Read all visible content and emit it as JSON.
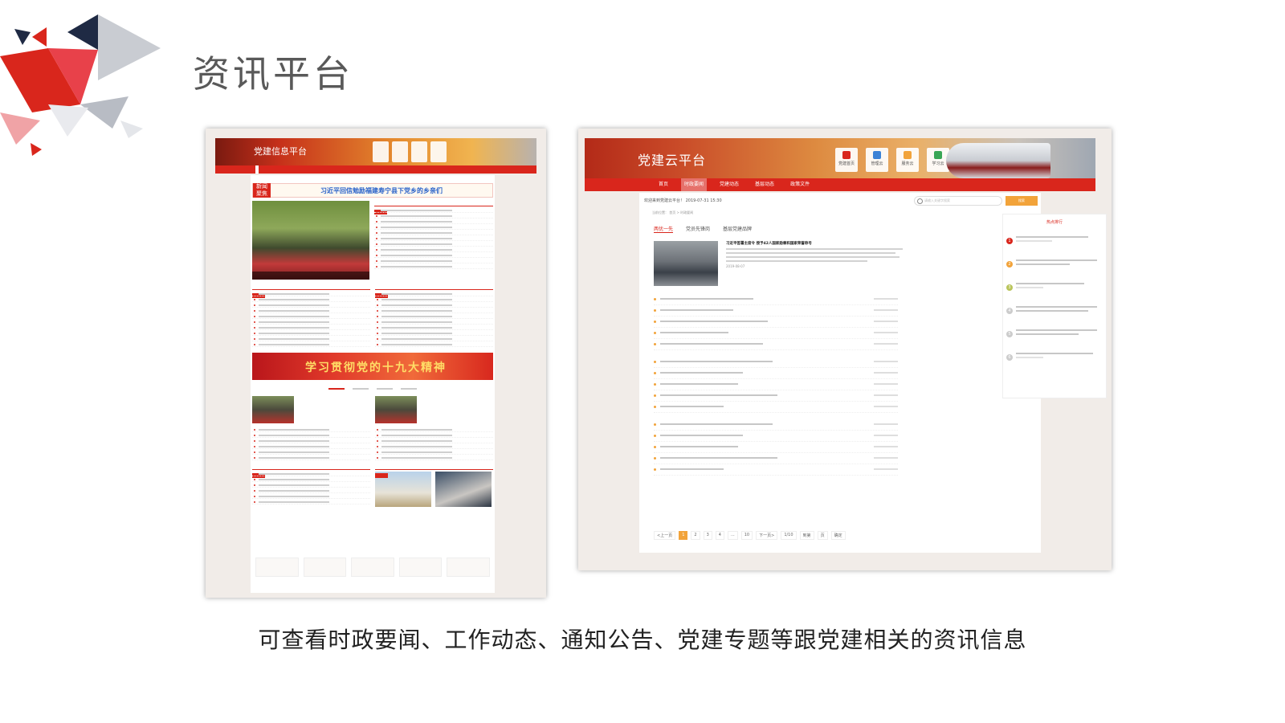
{
  "slide": {
    "title": "资讯平台",
    "caption": "可查看时政要闻、工作动态、通知公告、党建专题等跟党建相关的资讯信息"
  },
  "left_screen": {
    "site_title": "党建信息平台",
    "headline_badge": "新闻\n聚焦",
    "headline": "习近平回信勉励福建寿宁县下党乡的乡亲们",
    "banner": "学习贯彻党的十九大精神",
    "colors": {
      "brand": "#d9261c",
      "accent": "#f2a33a"
    }
  },
  "right_screen": {
    "site_title": "党建云平台",
    "header_icons": [
      "党建首页",
      "管理云",
      "服务云",
      "学习云"
    ],
    "nav": [
      "首页",
      "时政要闻",
      "党建动态",
      "基层动态",
      "政策文件"
    ],
    "nav_active": 1,
    "welcome": "欢迎来到党建云平台！ 2019-07-31 15:30",
    "search_placeholder": "请输入关键字搜索",
    "search_button": "搜索",
    "breadcrumb": "当前位置： 首页 > 时政要闻",
    "tabs": [
      "两优一先",
      "党员先锋岗",
      "基层党建品牌"
    ],
    "tab_active": 0,
    "featured": {
      "title": "习近平签署主席令 授予42人国家勋章和国家荣誉称号",
      "date": "2019-08-07"
    },
    "hot_title": "热点排行",
    "hot_ranks": [
      "1",
      "2",
      "3",
      "4",
      "5",
      "6"
    ],
    "pager": [
      "<上一页",
      "1",
      "2",
      "3",
      "4",
      "...",
      "10",
      "下一页>",
      "1/10",
      "到第",
      "页",
      "确定"
    ],
    "pager_active": 1,
    "colors": {
      "brand": "#d9261c",
      "accent": "#f2a33a"
    }
  }
}
